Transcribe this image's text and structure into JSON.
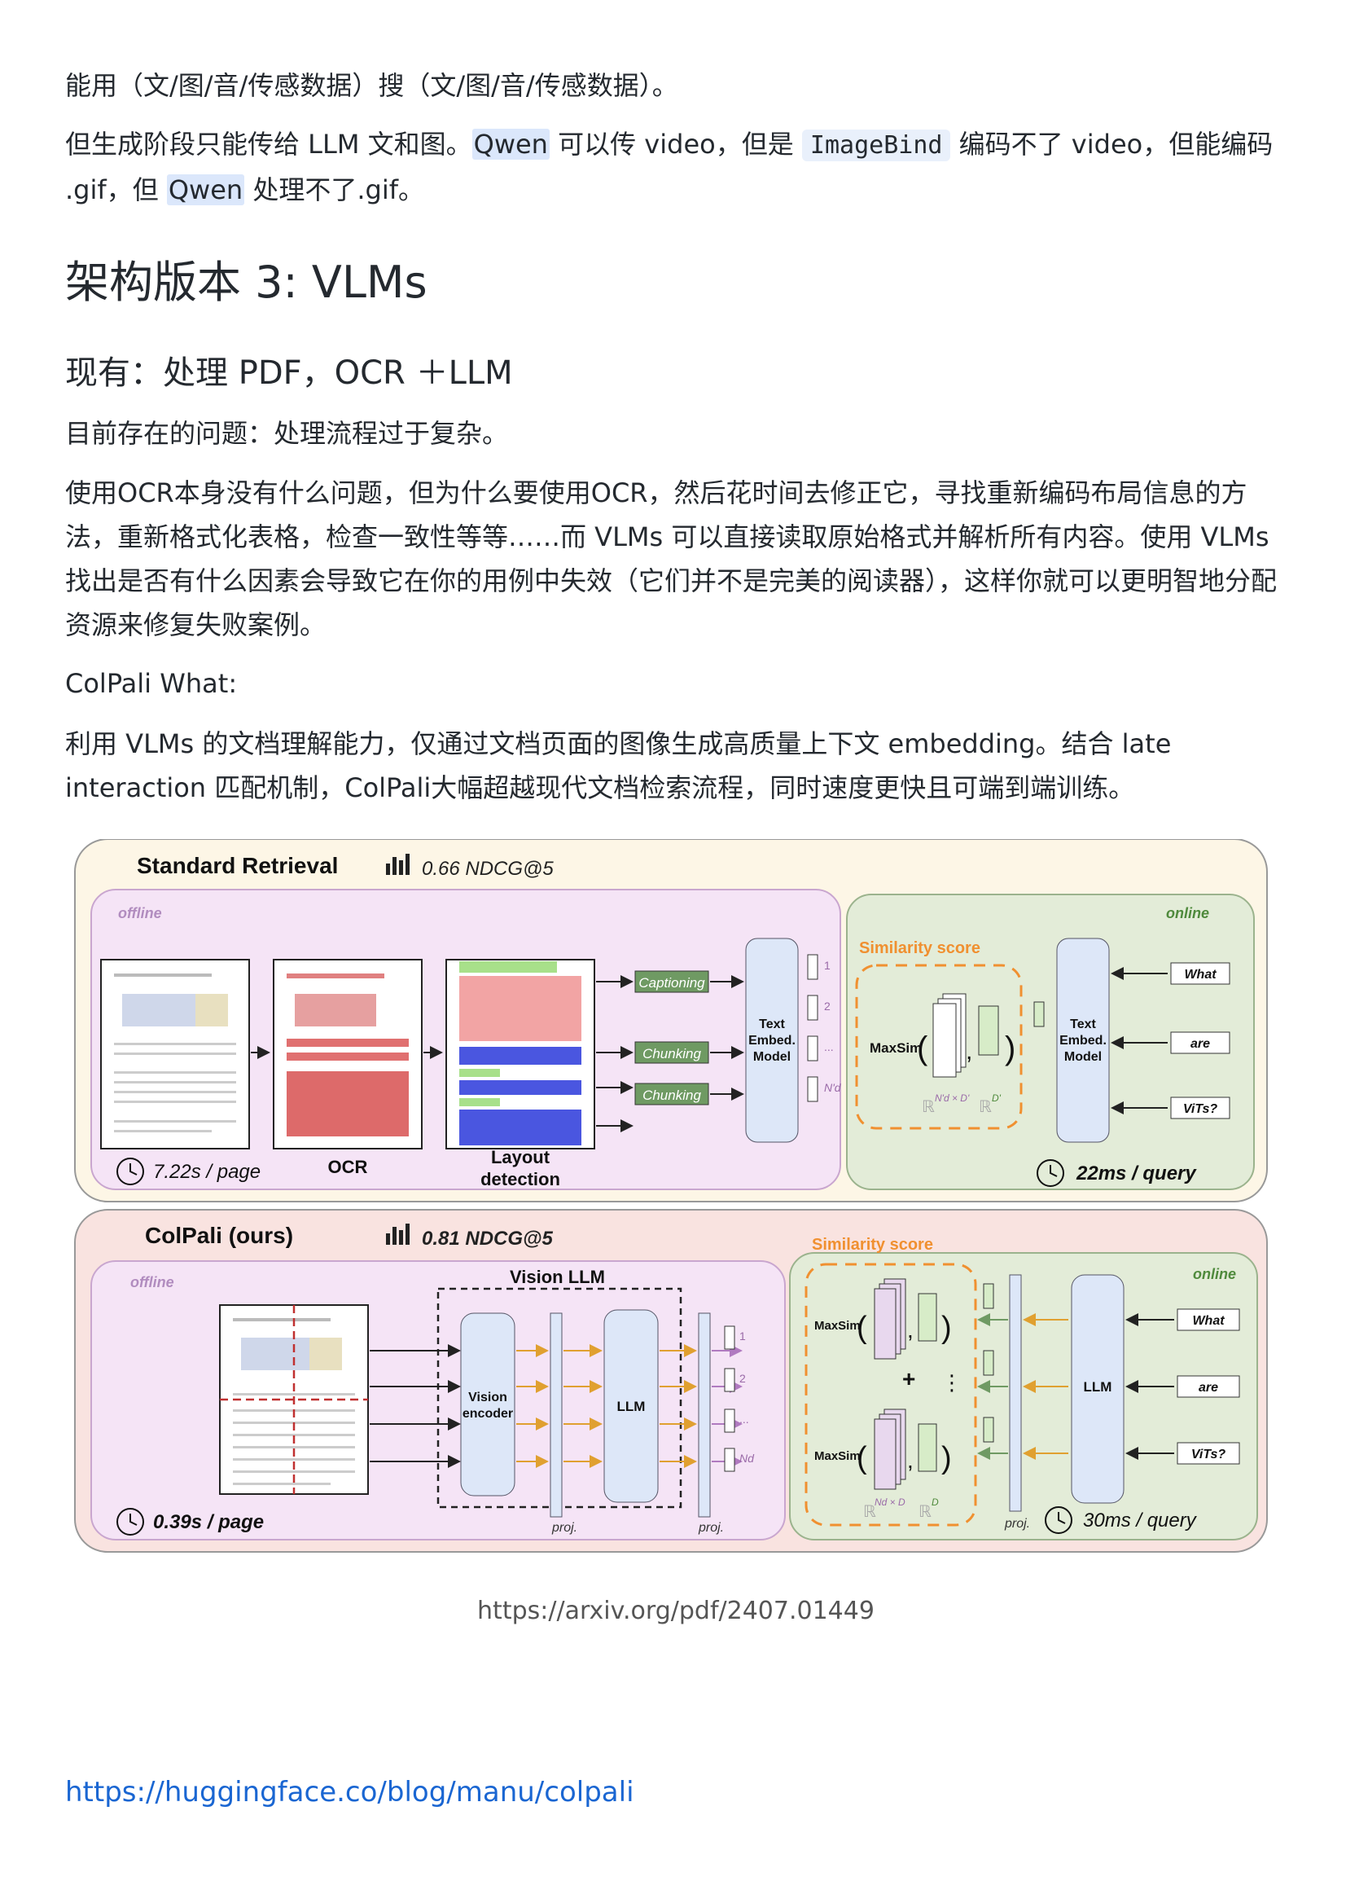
{
  "paragraphs": {
    "p1": "能用（文/图/音/传感数据）搜（文/图/音/传感数据）。",
    "p2_a": "但生成阶段只能传给 LLM 文和图。",
    "p2_qwen1": "Qwen",
    "p2_b": " 可以传 video，但是 ",
    "p2_imagebind": "ImageBind",
    "p2_c": " 编码不了 video，但能编码 .gif，但 ",
    "p2_qwen2": "Qwen",
    "p2_d": " 处理不了.gif。"
  },
  "heading_main": "架构版本 3: VLMs",
  "heading_sub": "现有：处理 PDF，OCR ＋LLM",
  "problem": "目前存在的问题：处理流程过于复杂。",
  "body_text": "使用OCR本身没有什么问题，但为什么要使用OCR，然后花时间去修正它，寻找重新编码布局信息的方法，重新格式化表格，检查一致性等等……而 VLMs 可以直接读取原始格式并解析所有内容。使用 VLMs 找出是否有什么因素会导致它在你的用例中失效（它们并不是完美的阅读器），这样你就可以更明智地分配资源来修复失败案例。",
  "colpali_what": "ColPali What:",
  "colpali_desc": "利用 VLMs 的文档理解能力，仅通过文档页面的图像生成高质量上下文 embedding。结合 late interaction 匹配机制，ColPali大幅超越现代文档检索流程，同时速度更快且可端到端训练。",
  "figure": {
    "standard": {
      "title": "Standard Retrieval",
      "score": "0.66 NDCG@5",
      "offline": "offline",
      "online": "online",
      "time_page": "7.22s / page",
      "ocr": "OCR",
      "layout": "Layout",
      "detection": "detection",
      "captioning": "Captioning",
      "chunking1": "Chunking",
      "chunking2": "Chunking",
      "model_l1": "Text",
      "model_l2": "Embed.",
      "model_l3": "Model",
      "similarity": "Similarity score",
      "maxsim": "MaxSim",
      "dim_left": "ℝ",
      "dim_left_sup": "N'd × D'",
      "dim_right": "ℝ",
      "dim_right_sup": "D'",
      "q_what": "What",
      "q_are": "are",
      "q_vits": "ViTs?",
      "time_query": "22ms / query",
      "idx1": "1",
      "idx2": "2",
      "idx3": "...",
      "idx4": "N'd"
    },
    "colpali": {
      "title": "ColPali (ours)",
      "score": "0.81 NDCG@5",
      "offline": "offline",
      "online": "online",
      "vision_llm": "Vision LLM",
      "vision_l1": "Vision",
      "vision_l2": "encoder",
      "llm": "LLM",
      "proj": "proj.",
      "time_page": "0.39s / page",
      "similarity": "Similarity score",
      "maxsim": "MaxSim",
      "plus": "+",
      "dots": "⋮",
      "dim_left": "ℝ",
      "dim_left_sup": "Nd × D",
      "dim_right": "ℝ",
      "dim_right_sup": "D",
      "q_what": "What",
      "q_are": "are",
      "q_vits": "ViTs?",
      "time_query": "30ms / query",
      "idx1": "1",
      "idx2": "2",
      "idx3": "...",
      "idx4": "Nd"
    }
  },
  "caption": "https://arxiv.org/pdf/2407.01449",
  "bottom_link": "https://huggingface.co/blog/manu/colpali",
  "colors": {
    "link": "#1a66d2",
    "offline_bg": "#f5e4f6",
    "online_bg": "#e3ecd8",
    "panel1_bg": "#fdf6e6",
    "panel2_bg": "#f9e3e0",
    "model_blue": "#dde7f8",
    "orange": "#f09030",
    "green_tag": "#6f9a63"
  }
}
